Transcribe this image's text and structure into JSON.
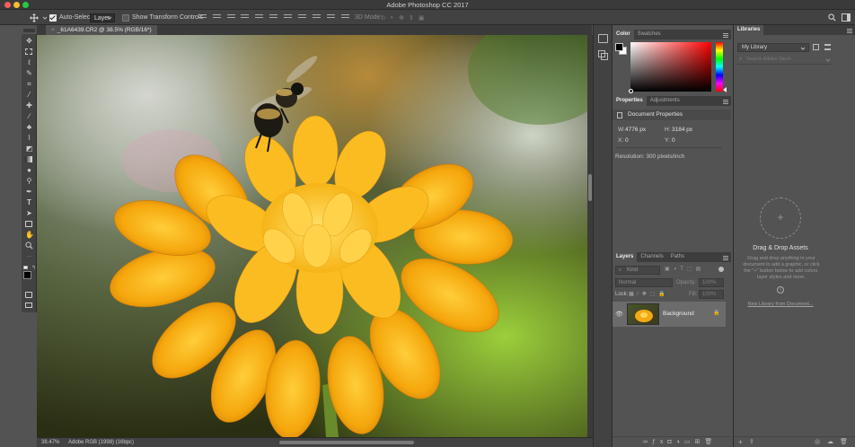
{
  "window": {
    "title": "Adobe Photoshop CC 2017"
  },
  "options_bar": {
    "auto_select_label": "Auto-Select:",
    "auto_select_value": "Layer",
    "show_transform_label": "Show Transform Controls",
    "mode_3d_label": "3D Mode:"
  },
  "document": {
    "tab_label": "_61A6439.CR2 @ 38.5% (RGB/16*)",
    "status_zoom": "38.47%",
    "status_profile": "Adobe RGB (1998) (16bpc)"
  },
  "color_panel": {
    "tabs": [
      "Color",
      "Swatches"
    ]
  },
  "properties_panel": {
    "tabs": [
      "Properties",
      "Adjustments"
    ],
    "section_title": "Document Properties",
    "w_label": "W:",
    "w_value": "4776 px",
    "h_label": "H:",
    "h_value": "3184 px",
    "x_label": "X:",
    "x_value": "0",
    "y_label": "Y:",
    "y_value": "0",
    "resolution": "Resolution: 300 pixels/inch"
  },
  "layers_panel": {
    "tabs": [
      "Layers",
      "Channels",
      "Paths"
    ],
    "filter_kind": "Kind",
    "blend_mode": "Normal",
    "opacity_label": "Opacity:",
    "opacity_value": "100%",
    "lock_label": "Lock:",
    "fill_label": "Fill:",
    "fill_value": "100%",
    "layers": [
      {
        "name": "Background"
      }
    ]
  },
  "libraries_panel": {
    "tab": "Libraries",
    "library_select": "My Library",
    "search_placeholder": "Search Adobe Stock",
    "dnd_title": "Drag & Drop Assets",
    "dnd_text": "Drag and drop anything in your document to add a graphic, or click the \"+\" button below to add colors, layer styles and more.",
    "new_library_link": "New Library from Document..."
  },
  "colors": {
    "panel_bg": "#535353",
    "dark_bg": "#424242",
    "active_tab": "#535353"
  }
}
